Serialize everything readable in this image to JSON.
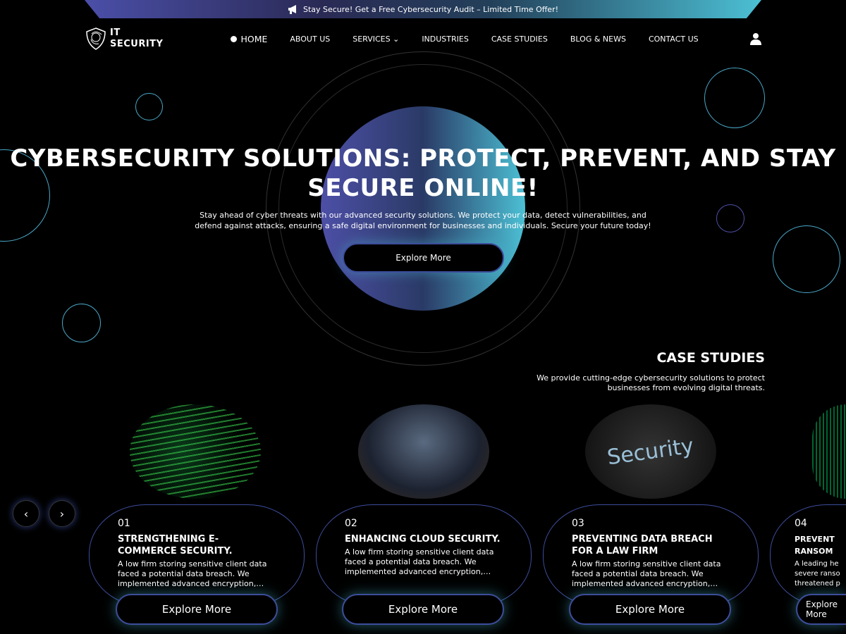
{
  "promo": {
    "text": "Stay Secure! Get a Free Cybersecurity Audit – Limited Time Offer!",
    "icon": "megaphone-icon"
  },
  "logo": {
    "line1": "IT",
    "line2": "SECURITY"
  },
  "nav": {
    "items": [
      "HOME",
      "ABOUT US",
      "SERVICES",
      "INDUSTRIES",
      "CASE STUDIES",
      "BLOG & NEWS",
      "CONTACT US"
    ]
  },
  "hero": {
    "title": "CYBERSECURITY SOLUTIONS: PROTECT, PREVENT, AND STAY SECURE ONLINE!",
    "subtitle": "Stay ahead of cyber threats with our advanced security solutions. We protect your data, detect vulnerabilities, and defend against attacks, ensuring a safe digital environment for businesses and individuals. Secure your future today!",
    "cta": "Explore More"
  },
  "case_studies": {
    "title": "CASE STUDIES",
    "subtitle": "We provide cutting-edge cybersecurity solutions to protect businesses from evolving digital threats.",
    "cards": [
      {
        "num": "01",
        "title": "STRENGTHENING E-COMMERCE SECURITY.",
        "desc": "A low firm storing sensitive client data faced a potential data breach. We implemented advanced encryption, access controls",
        "button": "Explore More"
      },
      {
        "num": "02",
        "title": "ENHANCING CLOUD SECURITY.",
        "desc": "A low firm storing sensitive client data faced a potential data breach. We implemented advanced encryption, access controls",
        "button": "Explore More"
      },
      {
        "num": "03",
        "title": "PREVENTING DATA BREACH FOR A LAW FIRM",
        "desc": "A low firm storing sensitive client data faced a potential data breach. We implemented advanced encryption, access controls",
        "button": "Explore More"
      },
      {
        "num": "04",
        "title": "PREVENT RANSOM",
        "desc": "A leading he severe ranso threatened p",
        "button": "Explore More"
      }
    ],
    "image_texts": {
      "security": "Security"
    }
  },
  "colors": {
    "accent_purple": "#4d4fa6",
    "accent_cyan": "#4cc0d4"
  }
}
